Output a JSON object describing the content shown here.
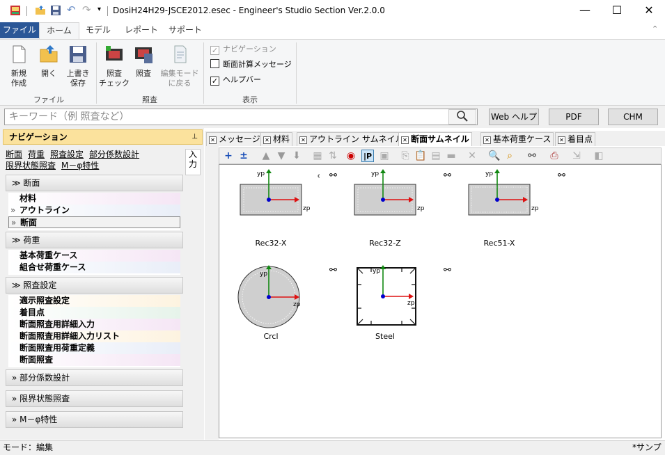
{
  "window": {
    "title": "DosiH24H29-JSCE2012.esec - Engineer's Studio Section Ver.2.0.0",
    "minimize": "—",
    "maximize": "☐",
    "close": "✕"
  },
  "ribbon_tabs": [
    {
      "label": "ファイル"
    },
    {
      "label": "ホーム"
    },
    {
      "label": "モデル"
    },
    {
      "label": "レポート"
    },
    {
      "label": "サポート"
    }
  ],
  "ribbon": {
    "groups": {
      "file": {
        "label": "ファイル",
        "new": "新規\n作成",
        "open": "開く",
        "save": "上書き\n保存"
      },
      "check": {
        "label": "照査",
        "check_verify": "照査\nチェック",
        "check": "照査",
        "back_edit": "編集モード\nに戻る"
      },
      "view": {
        "label": "表示",
        "navigation": "ナビゲーション",
        "section_msg": "断面計算メッセージ",
        "helpbar": "ヘルプバー"
      }
    }
  },
  "search": {
    "placeholder": "キーワード（例 照査など）",
    "web_help": "Web ヘルプ",
    "pdf": "PDF",
    "chm": "CHM"
  },
  "nav": {
    "title": "ナビゲーション",
    "pin": "📌",
    "links_row1": [
      "断面",
      "荷重",
      "照査設定",
      "部分係数設計"
    ],
    "links_row2": [
      "限界状態照査",
      "M－φ特性"
    ],
    "side_tab": "入\n力",
    "sections": {
      "section": "断面",
      "load": "荷重",
      "check_setting": "照査設定",
      "partial": "部分係数設計",
      "limit": "限界状態照査",
      "mphi": "M－φ特性"
    },
    "items_section": [
      "材料",
      "アウトライン",
      "断面"
    ],
    "items_load": [
      "基本荷重ケース",
      "組合せ荷重ケース"
    ],
    "items_check": [
      "適示照査設定",
      "着目点",
      "断面照査用詳細入力",
      "断面照査用詳細入力リスト",
      "断面照査用荷重定義",
      "断面照査"
    ]
  },
  "doc_tabs": [
    "メッセージ",
    "材料",
    "アウトライン サムネイル",
    "断面サムネイル",
    "基本荷重ケース",
    "着目点"
  ],
  "thumbnails": {
    "yp": "yp",
    "zp": "zp",
    "items": [
      "Rec32-X",
      "Rec32-Z",
      "Rec51-X",
      "Crcl",
      "Steel"
    ]
  },
  "status": {
    "mode": "モード：編集",
    "right": "*サンプ"
  },
  "colors": {
    "file_tab": "#2b5797",
    "nav_header": "#fbe29d",
    "axis_y": "#118811",
    "axis_z": "#dd1111",
    "origin": "#0000cc"
  }
}
